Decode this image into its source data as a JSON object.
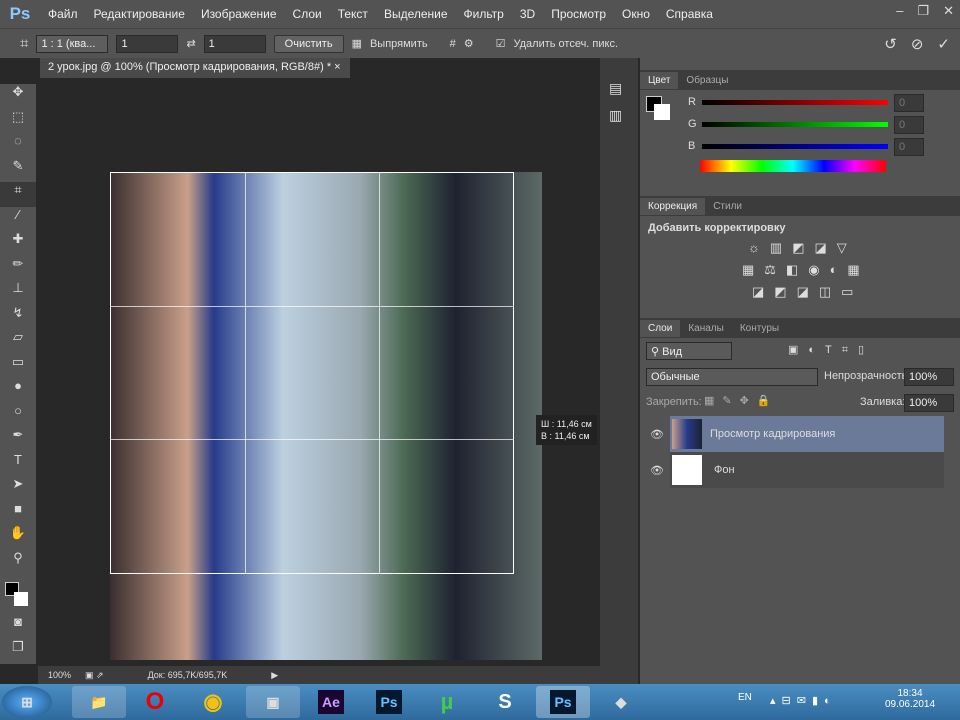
{
  "app": {
    "logo": "Ps",
    "menu": [
      "Файл",
      "Редактирование",
      "Изображение",
      "Слои",
      "Текст",
      "Выделение",
      "Фильтр",
      "3D",
      "Просмотр",
      "Окно",
      "Справка"
    ]
  },
  "options": {
    "ratio": "1 : 1 (ква...",
    "width": "1",
    "height": "1",
    "clear": "Очистить",
    "straighten": "Выпрямить",
    "delete_cropped": "Удалить отсеч. пикс."
  },
  "document": {
    "tab": "2 урок.jpg @ 100% (Просмотр кадрирования, RGB/8#) *",
    "size_w": "Ш : 11,46 см",
    "size_h": "В : 11,46 см"
  },
  "status": {
    "zoom": "100%",
    "doc": "Док: 695,7K/695,7K"
  },
  "color_panel": {
    "tabs": [
      "Цвет",
      "Образцы"
    ],
    "channels": [
      "R",
      "G",
      "B"
    ],
    "values": [
      "0",
      "0",
      "0"
    ]
  },
  "adjust_panel": {
    "tabs": [
      "Коррекция",
      "Стили"
    ],
    "title": "Добавить корректировку"
  },
  "layers_panel": {
    "tabs": [
      "Слои",
      "Каналы",
      "Контуры"
    ],
    "filter": "Вид",
    "blend": "Обычные",
    "opacity_label": "Непрозрачность:",
    "opacity": "100%",
    "lock_label": "Закрепить:",
    "fill_label": "Заливка:",
    "fill": "100%",
    "layers": [
      {
        "name": "Просмотр кадрирования",
        "selected": true
      },
      {
        "name": "Фон",
        "selected": false
      }
    ]
  },
  "taskbar": {
    "lang": "EN",
    "time": "18:34",
    "date": "09.06.2014",
    "apps": [
      "Ae",
      "Ps",
      "Ps"
    ]
  }
}
